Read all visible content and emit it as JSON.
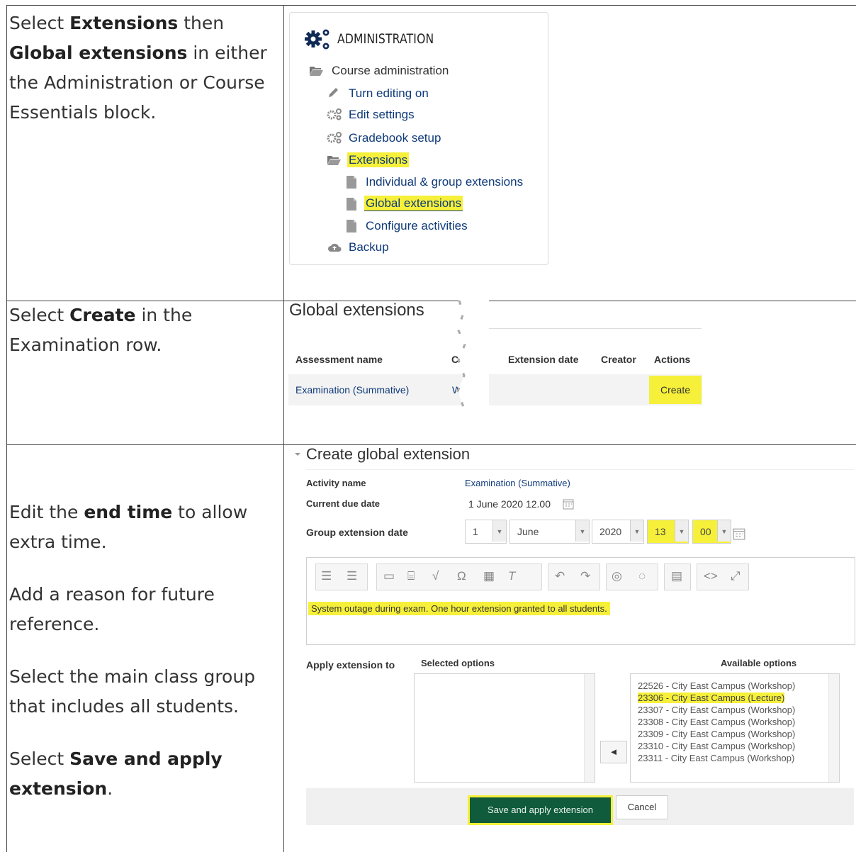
{
  "rows": [
    {
      "instruction": [
        {
          "parts": [
            {
              "t": "Select "
            },
            {
              "b": "Extensions"
            },
            {
              "t": " then "
            },
            {
              "b": "Global extensions"
            },
            {
              "t": " in either the Administration or Course Essentials block."
            }
          ]
        }
      ]
    },
    {
      "instruction": [
        {
          "parts": [
            {
              "t": "Select "
            },
            {
              "b": "Create"
            },
            {
              "t": " in the Examination row."
            }
          ]
        }
      ]
    },
    {
      "instruction": [
        {
          "parts": [
            {
              "t": "Edit the "
            },
            {
              "b": "end time"
            },
            {
              "t": " to allow extra time."
            }
          ]
        },
        {
          "parts": [
            {
              "t": "Add a reason for future reference."
            }
          ]
        },
        {
          "parts": [
            {
              "t": "Select the main class group that includes all students."
            }
          ]
        },
        {
          "parts": [
            {
              "t": "Select "
            },
            {
              "b": "Save and apply extension"
            },
            {
              "t": "."
            }
          ]
        }
      ]
    }
  ],
  "admin": {
    "title": "ADMINISTRATION",
    "course_admin": "Course administration",
    "turn_editing": "Turn editing on",
    "edit_settings": "Edit settings",
    "gradebook": "Gradebook setup",
    "extensions": "Extensions",
    "individual": "Individual & group extensions",
    "global": "Global extensions",
    "configure": "Configure activities",
    "backup": "Backup"
  },
  "global_ext": {
    "title": "Global extensions",
    "col_assessment": "Assessment name",
    "col_c": "C",
    "col_ext_date": "Extension date",
    "col_creator": "Creator",
    "col_actions": "Actions",
    "row_name": "Examination (Summative)",
    "row_c": "W",
    "row_action": "Create"
  },
  "create_ext": {
    "title": "Create global extension",
    "activity_label": "Activity name",
    "activity_value": "Examination (Summative)",
    "due_label": "Current due date",
    "due_value": "1 June 2020 12.00",
    "group_label": "Group extension date",
    "day": "1",
    "month": "June",
    "year": "2020",
    "hour": "13",
    "minute": "00",
    "reason": "System outage during exam. One hour extension granted to all students.",
    "apply_label": "Apply extension to",
    "selected_label": "Selected options",
    "available_label": "Available options",
    "options": [
      "22526 - City East Campus (Workshop)",
      "23306 - City East Campus (Lecture)",
      "23307 - City East Campus (Workshop)",
      "23308 - City East Campus (Workshop)",
      "23309 - City East Campus (Workshop)",
      "23310 - City East Campus (Workshop)",
      "23311 - City East Campus (Workshop)"
    ],
    "highlighted_option": 1,
    "save_label": "Save and apply extension",
    "cancel_label": "Cancel",
    "move_label": "◄"
  },
  "colors": {
    "highlight": "#f6f03a",
    "link": "#0f3a7a",
    "save": "#0f5b3b"
  }
}
